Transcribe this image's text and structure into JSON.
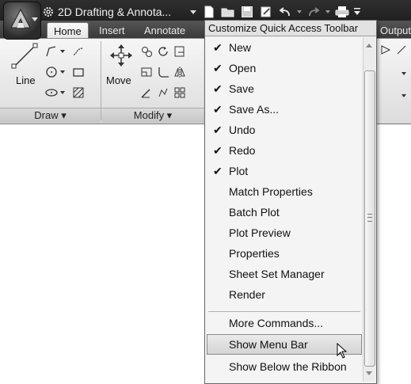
{
  "titlebar": {
    "workspace_label": "2D Drafting & Annota...",
    "qat_icons": [
      "new-icon",
      "open-icon",
      "save-icon",
      "plot-preview-icon",
      "undo-icon",
      "redo-icon",
      "plot-icon",
      "customize-arrow-icon"
    ]
  },
  "ribbon": {
    "tabs": [
      {
        "label": "Home",
        "active": true
      },
      {
        "label": "Insert",
        "active": false
      },
      {
        "label": "Annotate",
        "active": false
      },
      {
        "label": "Output",
        "active": false
      }
    ],
    "draw_panel": {
      "big_button": "Line",
      "title": "Draw ▾"
    },
    "modify_panel": {
      "big_button": "Move",
      "title": "Modify ▾"
    }
  },
  "menu": {
    "header": "Customize Quick Access Toolbar",
    "items": [
      {
        "label": "New",
        "checked": true
      },
      {
        "label": "Open",
        "checked": true
      },
      {
        "label": "Save",
        "checked": true
      },
      {
        "label": "Save As...",
        "checked": true
      },
      {
        "label": "Undo",
        "checked": true
      },
      {
        "label": "Redo",
        "checked": true
      },
      {
        "label": "Plot",
        "checked": true
      },
      {
        "label": "Match Properties",
        "checked": false
      },
      {
        "label": "Batch Plot",
        "checked": false
      },
      {
        "label": "Plot Preview",
        "checked": false
      },
      {
        "label": "Properties",
        "checked": false
      },
      {
        "label": "Sheet Set Manager",
        "checked": false
      },
      {
        "label": "Render",
        "checked": false
      }
    ],
    "extra_items": [
      {
        "label": "More Commands...",
        "highlighted": false
      },
      {
        "label": "Show Menu Bar",
        "highlighted": true
      },
      {
        "label": "Show Below the Ribbon",
        "highlighted": false
      }
    ],
    "check_glyph": "✔"
  }
}
